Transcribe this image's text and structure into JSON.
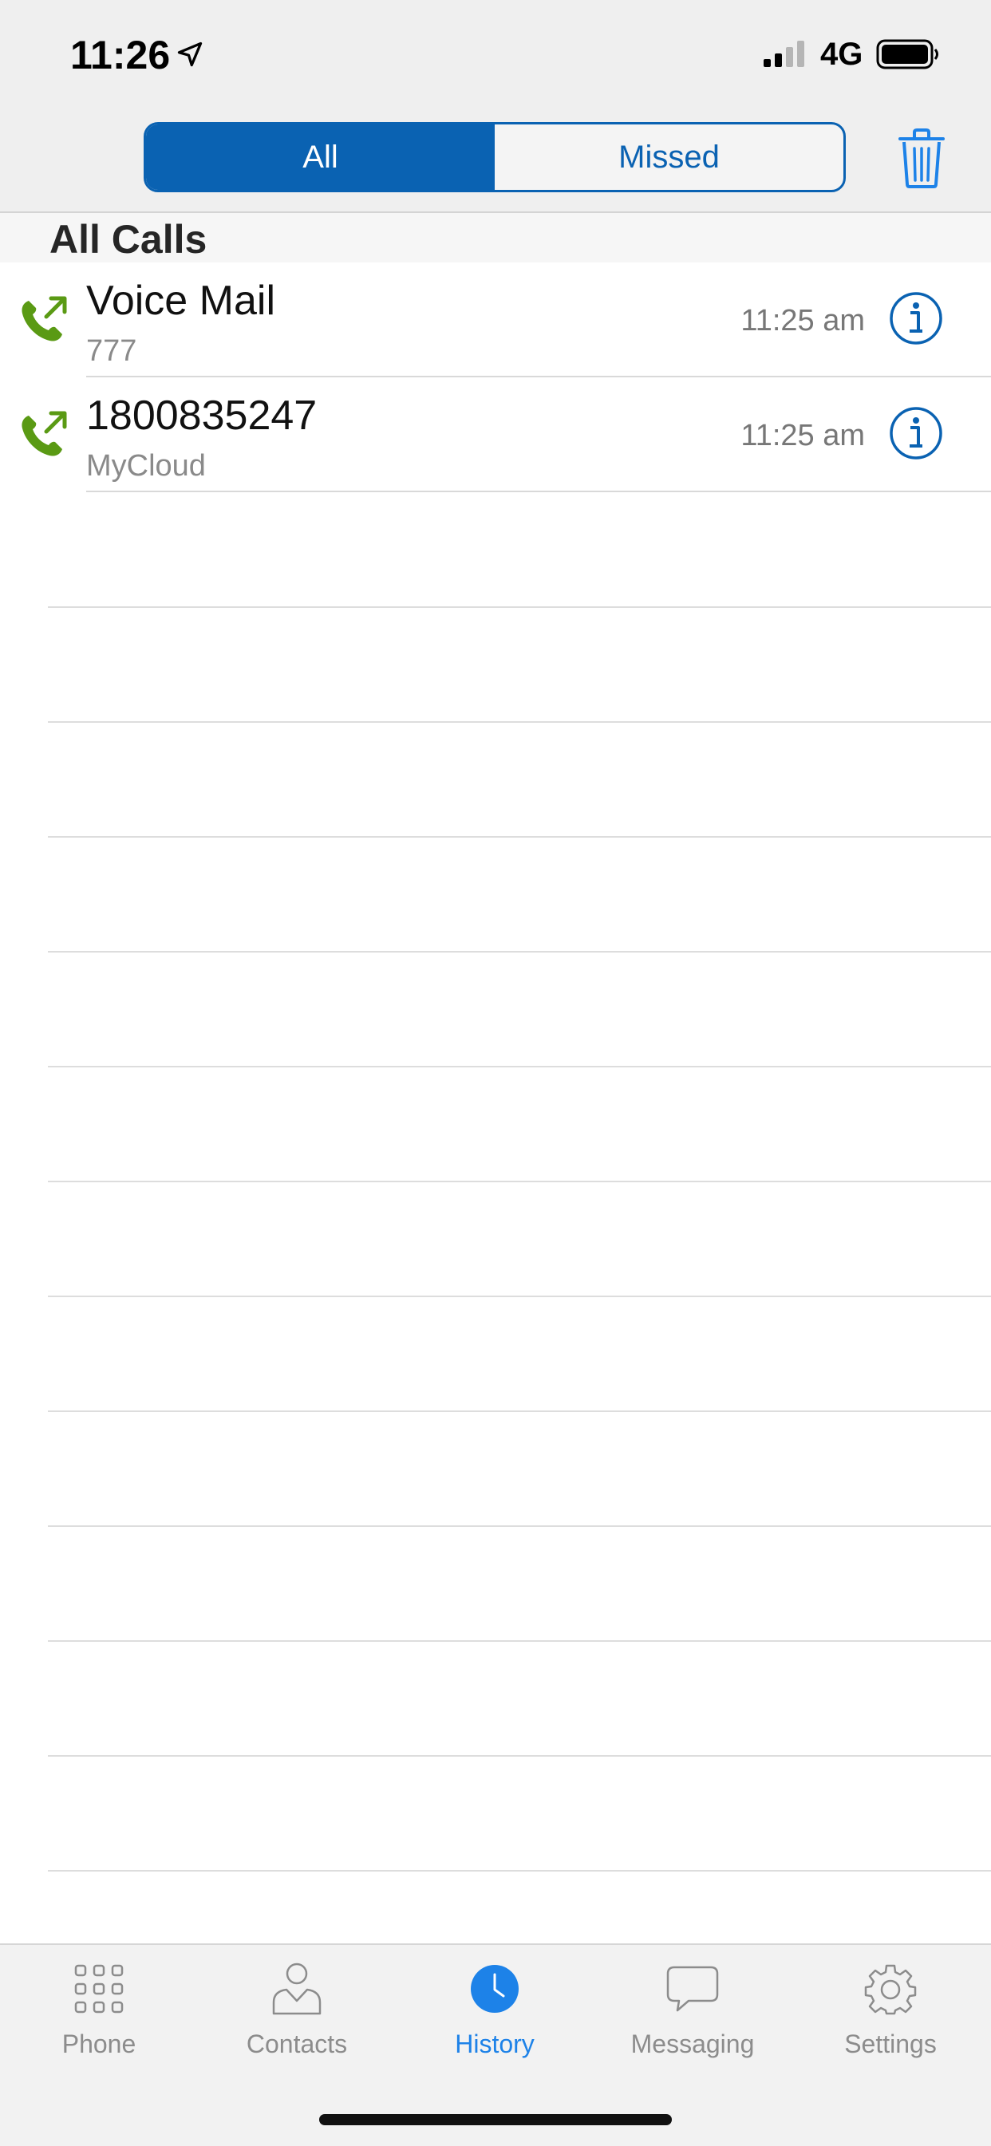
{
  "status_bar": {
    "time": "11:26",
    "network": "4G"
  },
  "segments": {
    "all_label": "All",
    "missed_label": "Missed",
    "active": "All"
  },
  "section": {
    "title": "All Calls"
  },
  "calls": [
    {
      "name": "Voice Mail",
      "sub": "777",
      "time": "11:25 am",
      "icon": "outgoing-call-icon"
    },
    {
      "name": "1800835247",
      "sub": "MyCloud",
      "time": "11:25 am",
      "icon": "outgoing-call-icon"
    }
  ],
  "tabs": [
    {
      "label": "Phone",
      "icon": "dialpad-icon",
      "active": false
    },
    {
      "label": "Contacts",
      "icon": "person-icon",
      "active": false
    },
    {
      "label": "History",
      "icon": "clock-icon",
      "active": true
    },
    {
      "label": "Messaging",
      "icon": "chat-bubble-icon",
      "active": false
    },
    {
      "label": "Settings",
      "icon": "gear-icon",
      "active": false
    }
  ],
  "colors": {
    "accent": "#0a62b2",
    "tab_active": "#1d82e8",
    "call_icon": "#5a9a14"
  }
}
